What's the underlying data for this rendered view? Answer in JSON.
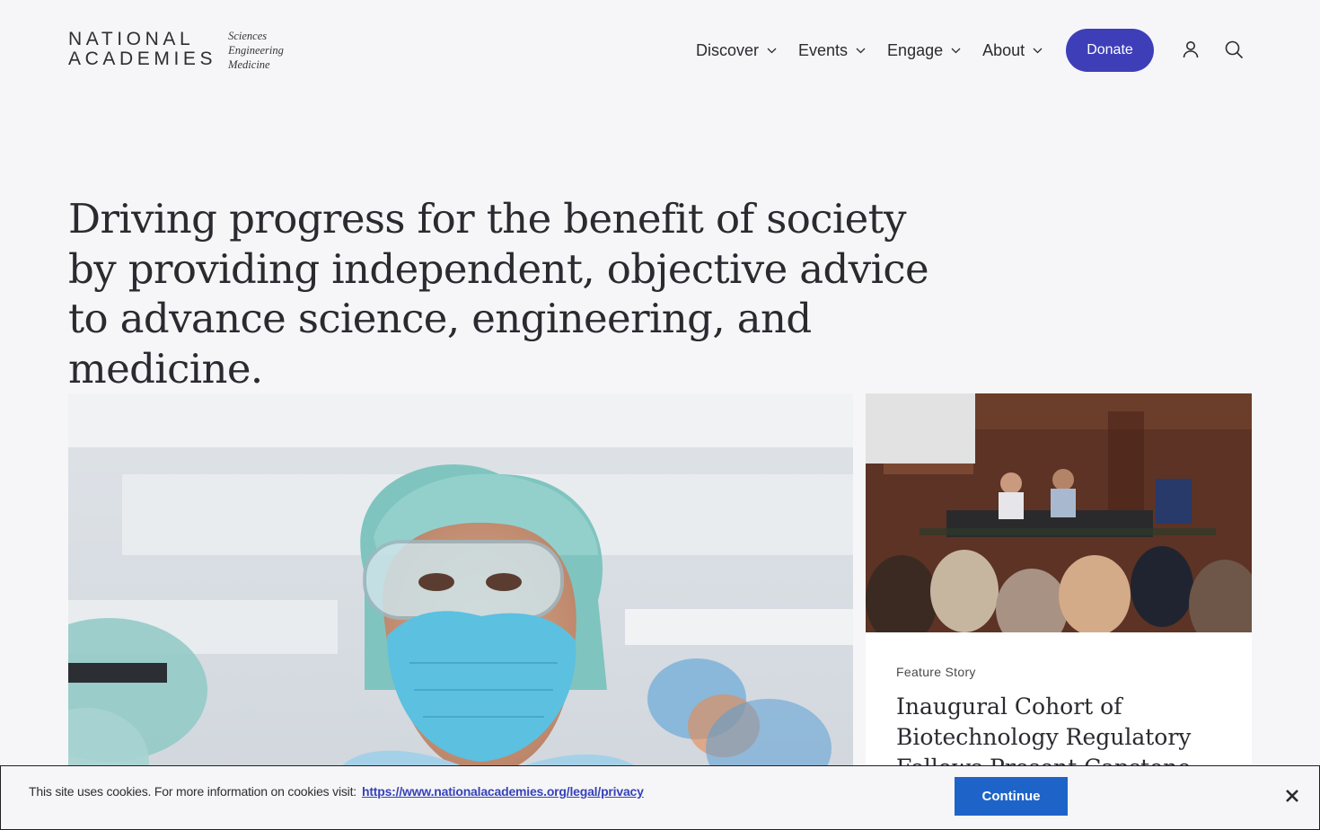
{
  "header": {
    "logo": {
      "line1": "NATIONAL",
      "line2": "ACADEMIES",
      "sub": [
        "Sciences",
        "Engineering",
        "Medicine"
      ]
    },
    "nav": [
      {
        "label": "Discover",
        "icon": "chevron-down-icon"
      },
      {
        "label": "Events",
        "icon": "chevron-down-icon"
      },
      {
        "label": "Engage",
        "icon": "chevron-down-icon"
      },
      {
        "label": "About",
        "icon": "chevron-down-icon"
      }
    ],
    "donate_label": "Donate",
    "icons": [
      "user-icon",
      "search-icon"
    ],
    "accent_color": "#3e3fb8"
  },
  "hero": {
    "title": "Driving progress for the benefit of society by providing independent, objective advice to advance science, engineering, and medicine."
  },
  "feature": {
    "kicker": "Feature Story",
    "title": "Inaugural Cohort of Biotechnology Regulatory Fellows Present Capstone"
  },
  "cookie_banner": {
    "text": "This site uses cookies. For more information on cookies visit:",
    "link": "https://www.nationalacademies.org/legal/privacy",
    "continue_label": "Continue",
    "close_icon": "close-icon",
    "button_color": "#1e64c8"
  }
}
